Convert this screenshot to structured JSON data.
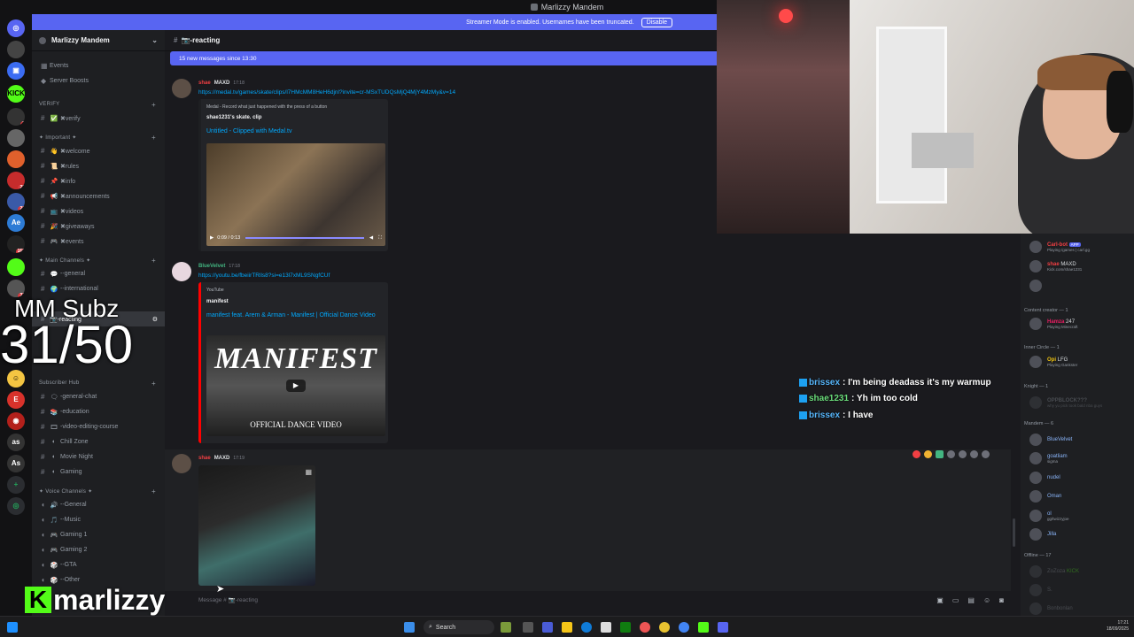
{
  "window": {
    "title": "Marlizzy Mandem"
  },
  "streamer_banner": {
    "text": "Streamer Mode is enabled. Usernames have been truncated.",
    "button": "Disable"
  },
  "server": {
    "name": "Marlizzy Mandem"
  },
  "sidebar": {
    "items": [
      {
        "emoji": "",
        "label": "Events"
      },
      {
        "emoji": "",
        "label": "Server Boosts"
      }
    ],
    "categories": {
      "verify": "VERIFY",
      "important": "✦ Important ✦",
      "main": "✦ Main Channels ✦",
      "subhub": "Subscriber Hub",
      "voice": "✦ Voice Channels ✦"
    },
    "verify_channels": [
      {
        "emoji": "✅",
        "label": "✖verify"
      }
    ],
    "important_channels": [
      {
        "emoji": "👋",
        "label": "✖welcome"
      },
      {
        "emoji": "📜",
        "label": "✖rules"
      },
      {
        "emoji": "📌",
        "label": "✖info"
      },
      {
        "emoji": "📢",
        "label": "✖announcements"
      },
      {
        "emoji": "📺",
        "label": "✖videos"
      },
      {
        "emoji": "🎉",
        "label": "✖giveaways"
      },
      {
        "emoji": "🎮",
        "label": "✖events"
      }
    ],
    "main_channels": [
      {
        "emoji": "💬",
        "label": "--general"
      },
      {
        "emoji": "🌍",
        "label": "--international"
      }
    ],
    "sub_channels": [
      {
        "emoji": "🗨",
        "label": "-general-chat"
      },
      {
        "emoji": "📚",
        "label": "-education"
      },
      {
        "emoji": "🎞",
        "label": "-video-editing-course"
      },
      {
        "emoji": "",
        "label": "Chill Zone"
      },
      {
        "emoji": "",
        "label": "Movie Night"
      },
      {
        "emoji": "",
        "label": "Gaming"
      }
    ],
    "voice_channels": [
      {
        "emoji": "🔊",
        "label": "--General"
      },
      {
        "emoji": "🎵",
        "label": "--Music"
      },
      {
        "emoji": "🎮",
        "label": "Gaming 1"
      },
      {
        "emoji": "🎮",
        "label": "Gaming 2"
      },
      {
        "emoji": "🎲",
        "label": "--GTA"
      },
      {
        "emoji": "🎲",
        "label": "--Other"
      }
    ]
  },
  "channel": {
    "name": "📷-reacting",
    "new_messages": "15 new messages since 13:30"
  },
  "messages": [
    {
      "user": "shae",
      "tag": "MAXD",
      "time": "17:18",
      "link": "https://medal.tv/games/skate/clips/l7HMcMM8HeH6djnl?invite=cr-MSxTUDQsMjQ4MjY4MzMy&v=14",
      "embed_provider": "Medal - Record what just happened with the press of a button",
      "embed_author": "shae1231's skate. clip",
      "embed_title": "Untitled - Clipped with Medal.tv",
      "video_time": "0:09 / 0:13"
    },
    {
      "user": "BlueVelvet",
      "time": "17:18",
      "link": "https://youtu.be/fbeiirTRlls8?si=e13l7xML9SNgfCUf",
      "embed_provider": "YouTube",
      "embed_author": "manifest",
      "embed_title": "manifest feat. Arem & Arman - Manifest | Official Dance Video",
      "thumb_text": "MANIFEST",
      "thumb_sub": "OFFICIAL DANCE VIDEO"
    },
    {
      "user": "shae",
      "tag": "MAXD",
      "time": "17:19"
    }
  ],
  "message_input": {
    "placeholder": "Message # 📷-reacting"
  },
  "members": {
    "top": [
      {
        "name": "Carl-bot",
        "tag": "APP",
        "status": "Playing /games | carl.gg"
      },
      {
        "name": "shae",
        "tag": "MAXD",
        "status": "Kick.com/shae1231"
      },
      {
        "name": "",
        "status": ""
      }
    ],
    "content_creator_head": "Content creator — 1",
    "content_creator": [
      {
        "name": "Hamza",
        "tag": "247",
        "status": "Playing Minecraft"
      }
    ],
    "inner_circle_head": "Inner Circle — 1",
    "inner_circle": [
      {
        "name": "Opi",
        "tag": "LFG",
        "status": "Playing Gankster"
      }
    ],
    "knight_head": "Knight — 1",
    "knight": [
      {
        "name": "OPPBLOCK???",
        "status": "why yu pick took bald nba guys"
      }
    ],
    "mandem_head": "Mandem — 6",
    "mandem": [
      {
        "name": "BlueVelvet",
        "status": ""
      },
      {
        "name": "goatliam",
        "status": "sigma"
      },
      {
        "name": "nudel",
        "status": ""
      },
      {
        "name": "Oman",
        "status": ""
      },
      {
        "name": "ol",
        "status": "gg/twizzyjoe"
      },
      {
        "name": "Jilla",
        "status": ""
      }
    ],
    "offline_head": "Offline — 17",
    "offline": [
      {
        "name": "ZoZoza",
        "tag": "KICK"
      },
      {
        "name": "S."
      },
      {
        "name": "Bonbonlan"
      }
    ]
  },
  "overlay": {
    "subz_label": "MM Subz",
    "subz_count": "31/50",
    "kick_name": "marlizzy",
    "kick_letter": "K"
  },
  "twitch_chat": [
    {
      "name": "brissex",
      "text": ": I'm being deadass it's my warmup"
    },
    {
      "name": "shae1231",
      "text": ": Yh im too cold"
    },
    {
      "name": "brissex",
      "text": ": I have"
    }
  ],
  "taskbar": {
    "search": "Search",
    "time": "17:21",
    "date": "18/09/2025"
  },
  "rail_badges": [
    "3",
    "28",
    "20",
    "169",
    "37"
  ],
  "colors": {
    "blurple": "#5865f2",
    "kick_green": "#53fc18",
    "link": "#00a8fc",
    "twitch_name": "#56b5fa"
  }
}
